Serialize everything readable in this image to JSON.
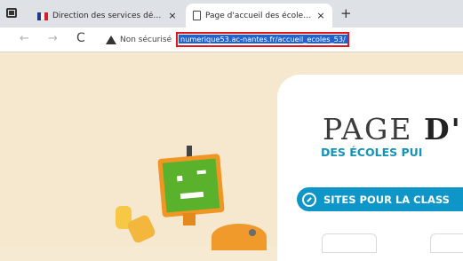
{
  "browser": {
    "tabs": [
      {
        "label": "Direction des services départeme"
      },
      {
        "label": "Page d'accueil des écoles publiq"
      }
    ],
    "new_tab_symbol": "+",
    "close_symbol": "×",
    "back_symbol": "←",
    "forward_symbol": "→",
    "reload_symbol": "C",
    "security_label": "Non sécurisé",
    "url": "numerique53.ac-nantes.fr/accueil_ecoles_53/"
  },
  "page": {
    "title_part1": "PAGE ",
    "title_part2": "D'",
    "subtitle": "DES ÉCOLES PUI",
    "sites_button_label": "SITES POUR LA CLASS"
  },
  "colors": {
    "accent_blue": "#0f96c9",
    "url_highlight": "#e3141a",
    "background": "#f5e8cf"
  }
}
